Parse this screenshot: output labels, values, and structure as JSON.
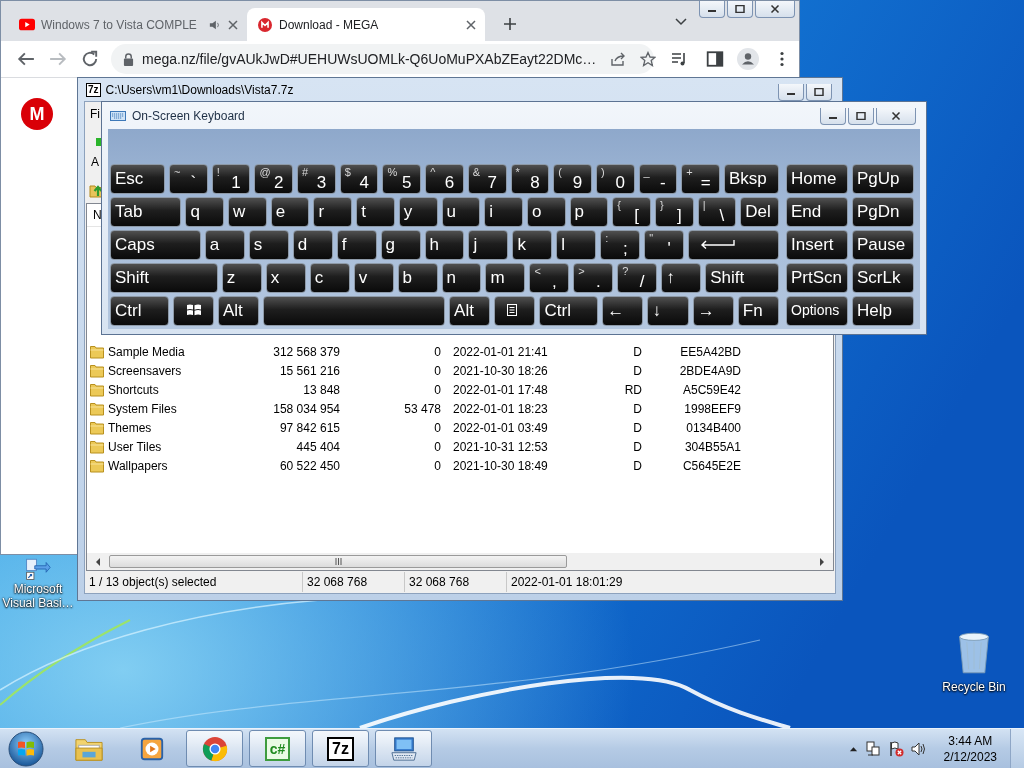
{
  "browser": {
    "tabs": [
      {
        "title": "Windows 7 to Vista COMPLE",
        "selected": false,
        "kind": "video",
        "audio": true
      },
      {
        "title": "Download - MEGA",
        "selected": true,
        "kind": "mega",
        "audio": false
      }
    ],
    "forward_disabled": true,
    "address": "mega.nz/file/gvAUkJwD#UEHUWsUOMLk-Q6UoMuPXAbZEayt22DMc…",
    "logo": "M"
  },
  "archive": {
    "icon": "7z",
    "title": "C:\\Users\\vm1\\Downloads\\Vista7.7z",
    "menu": [
      "Fi"
    ],
    "toolbar": [
      "A"
    ],
    "columns": [
      "N"
    ],
    "rows": [
      {
        "name": "Sample Media",
        "size": "312 568 379",
        "packed": "0",
        "modified": "2022-01-01 21:41",
        "attributes": "D",
        "crc": "EE5A42BD"
      },
      {
        "name": "Screensavers",
        "size": "15 561 216",
        "packed": "0",
        "modified": "2021-10-30 18:26",
        "attributes": "D",
        "crc": "2BDE4A9D"
      },
      {
        "name": "Shortcuts",
        "size": "13 848",
        "packed": "0",
        "modified": "2022-01-01 17:48",
        "attributes": "RD",
        "crc": "A5C59E42"
      },
      {
        "name": "System Files",
        "size": "158 034 954",
        "packed": "53 478",
        "modified": "2022-01-01 18:23",
        "attributes": "D",
        "crc": "1998EEF9"
      },
      {
        "name": "Themes",
        "size": "97 842 615",
        "packed": "0",
        "modified": "2022-01-01 03:49",
        "attributes": "D",
        "crc": "0134B400"
      },
      {
        "name": "User Tiles",
        "size": "445 404",
        "packed": "0",
        "modified": "2021-10-31 12:53",
        "attributes": "D",
        "crc": "304B55A1"
      },
      {
        "name": "Wallpapers",
        "size": "60 522 450",
        "packed": "0",
        "modified": "2021-10-30 18:49",
        "attributes": "D",
        "crc": "C5645E2E"
      }
    ],
    "status": [
      "1 / 13 object(s) selected",
      "32 068 768",
      "32 068 768",
      "2022-01-01 18:01:29"
    ]
  },
  "keyboard": {
    "title": "On-Screen Keyboard",
    "main_rows": [
      [
        {
          "kind": "key",
          "label": "Esc"
        },
        {
          "kind": "key",
          "label": "`",
          "shift": "~"
        },
        {
          "kind": "key",
          "label": "1",
          "shift": "!"
        },
        {
          "kind": "key",
          "label": "2",
          "shift": "@"
        },
        {
          "kind": "key",
          "label": "3",
          "shift": "#"
        },
        {
          "kind": "key",
          "label": "4",
          "shift": "$"
        },
        {
          "kind": "key",
          "label": "5",
          "shift": "%"
        },
        {
          "kind": "key",
          "label": "6",
          "shift": "^"
        },
        {
          "kind": "key",
          "label": "7",
          "shift": "&"
        },
        {
          "kind": "key",
          "label": "8",
          "shift": "*"
        },
        {
          "kind": "key",
          "label": "9",
          "shift": "("
        },
        {
          "kind": "key",
          "label": "0",
          "shift": ")"
        },
        {
          "kind": "key",
          "label": "-",
          "shift": "_"
        },
        {
          "kind": "key",
          "label": "=",
          "shift": "+"
        },
        {
          "kind": "key",
          "label": "Bksp"
        }
      ],
      [
        {
          "kind": "key",
          "label": "Tab"
        },
        {
          "kind": "key",
          "label": "q"
        },
        {
          "kind": "key",
          "label": "w"
        },
        {
          "kind": "key",
          "label": "e"
        },
        {
          "kind": "key",
          "label": "r"
        },
        {
          "kind": "key",
          "label": "t"
        },
        {
          "kind": "key",
          "label": "y"
        },
        {
          "kind": "key",
          "label": "u"
        },
        {
          "kind": "key",
          "label": "i"
        },
        {
          "kind": "key",
          "label": "o"
        },
        {
          "kind": "key",
          "label": "p"
        },
        {
          "kind": "key",
          "label": "[",
          "shift": "{"
        },
        {
          "kind": "key",
          "label": "]",
          "shift": "}"
        },
        {
          "kind": "key",
          "label": "\\",
          "shift": "|"
        },
        {
          "kind": "key",
          "label": "Del"
        }
      ],
      [
        {
          "kind": "key",
          "label": "Caps"
        },
        {
          "kind": "key",
          "label": "a"
        },
        {
          "kind": "key",
          "label": "s"
        },
        {
          "kind": "key",
          "label": "d"
        },
        {
          "kind": "key",
          "label": "f"
        },
        {
          "kind": "key",
          "label": "g"
        },
        {
          "kind": "key",
          "label": "h"
        },
        {
          "kind": "key",
          "label": "j"
        },
        {
          "kind": "key",
          "label": "k"
        },
        {
          "kind": "key",
          "label": "l"
        },
        {
          "kind": "key",
          "label": ";",
          "shift": ":"
        },
        {
          "kind": "key",
          "label": "'",
          "shift": "\""
        },
        {
          "kind": "enter"
        }
      ],
      [
        {
          "kind": "key",
          "label": "Shift"
        },
        {
          "kind": "key",
          "label": "z"
        },
        {
          "kind": "key",
          "label": "x"
        },
        {
          "kind": "key",
          "label": "c"
        },
        {
          "kind": "key",
          "label": "v"
        },
        {
          "kind": "key",
          "label": "b"
        },
        {
          "kind": "key",
          "label": "n"
        },
        {
          "kind": "key",
          "label": "m"
        },
        {
          "kind": "key",
          "label": ",",
          "shift": "<"
        },
        {
          "kind": "key",
          "label": ".",
          "shift": ">"
        },
        {
          "kind": "key",
          "label": "/",
          "shift": "?"
        },
        {
          "kind": "key",
          "label": "↑"
        },
        {
          "kind": "key",
          "label": "Shift"
        }
      ],
      [
        {
          "kind": "key",
          "label": "Ctrl"
        },
        {
          "kind": "windows"
        },
        {
          "kind": "key",
          "label": "Alt"
        },
        {
          "kind": "space"
        },
        {
          "kind": "key",
          "label": "Alt"
        },
        {
          "kind": "menu"
        },
        {
          "kind": "key",
          "label": "Ctrl"
        },
        {
          "kind": "key",
          "label": "←"
        },
        {
          "kind": "key",
          "label": "↓"
        },
        {
          "kind": "key",
          "label": "→"
        },
        {
          "kind": "key",
          "label": "Fn"
        }
      ]
    ],
    "side_rows": [
      [
        {
          "kind": "key",
          "label": "Home"
        },
        {
          "kind": "key",
          "label": "PgUp"
        }
      ],
      [
        {
          "kind": "key",
          "label": "End"
        },
        {
          "kind": "key",
          "label": "PgDn"
        }
      ],
      [
        {
          "kind": "key",
          "label": "Insert"
        },
        {
          "kind": "key",
          "label": "Pause"
        }
      ],
      [
        {
          "kind": "key",
          "label": "PrtScn"
        },
        {
          "kind": "key",
          "label": "ScrLk"
        }
      ],
      [
        {
          "kind": "small",
          "label": "Options"
        },
        {
          "kind": "key",
          "label": "Help"
        }
      ]
    ]
  },
  "desktop_icons": [
    {
      "kind": "shortcut",
      "label": "Microsoft Visual Basi…"
    },
    {
      "kind": "bin",
      "label": "Recycle Bin"
    }
  ],
  "taskbar": {
    "items": [
      {
        "kind": "explorer",
        "open": false
      },
      {
        "kind": "media",
        "open": false
      },
      {
        "kind": "browser",
        "open": true
      },
      {
        "kind": "csharp",
        "open": true,
        "label": "c#"
      },
      {
        "kind": "archiver",
        "open": true,
        "label": "7z"
      },
      {
        "kind": "keyboard",
        "open": true
      }
    ],
    "time": "3:44 AM",
    "date": "2/12/2023"
  }
}
